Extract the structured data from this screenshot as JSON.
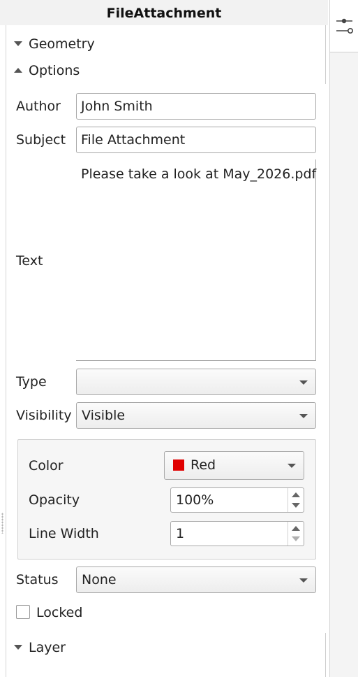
{
  "panel": {
    "title": "FileAttachment"
  },
  "sections": {
    "geometry": "Geometry",
    "options": "Options",
    "layer": "Layer"
  },
  "fields": {
    "author": {
      "label": "Author",
      "value": "John Smith"
    },
    "subject": {
      "label": "Subject",
      "value": "File Attachment"
    },
    "text": {
      "label": "Text",
      "value": "Please take a look at May_2026.pdf"
    },
    "type": {
      "label": "Type",
      "value": ""
    },
    "visibility": {
      "label": "Visibility",
      "value": "Visible"
    },
    "status": {
      "label": "Status",
      "value": "None"
    },
    "locked": {
      "label": "Locked",
      "checked": false
    }
  },
  "appearance": {
    "color": {
      "label": "Color",
      "value": "Red",
      "swatch": "#e00000"
    },
    "opacity": {
      "label": "Opacity",
      "value": "100%"
    },
    "line_width": {
      "label": "Line Width",
      "value": "1"
    }
  },
  "sidebar": {
    "tab_icon": "properties-sliders-icon"
  }
}
